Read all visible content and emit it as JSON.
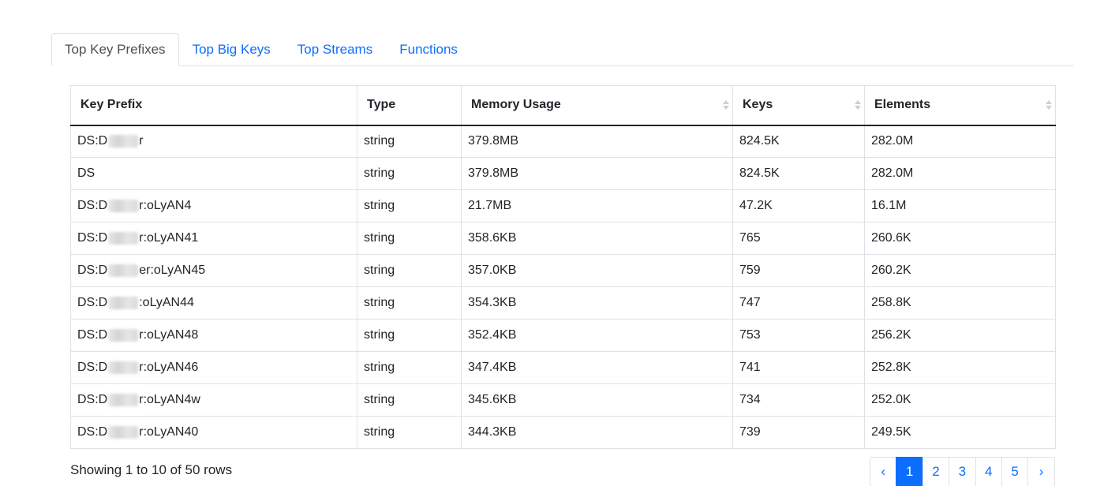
{
  "tabs": [
    {
      "label": "Top Key Prefixes",
      "active": true
    },
    {
      "label": "Top Big Keys",
      "active": false
    },
    {
      "label": "Top Streams",
      "active": false
    },
    {
      "label": "Functions",
      "active": false
    }
  ],
  "table": {
    "columns": [
      {
        "label": "Key Prefix",
        "sortable": false
      },
      {
        "label": "Type",
        "sortable": false
      },
      {
        "label": "Memory Usage",
        "sortable": true
      },
      {
        "label": "Keys",
        "sortable": true
      },
      {
        "label": "Elements",
        "sortable": true
      }
    ],
    "rows": [
      {
        "prefix_start": "DS:D",
        "prefix_end": "r",
        "redacted": true,
        "type": "string",
        "memory": "379.8MB",
        "keys": "824.5K",
        "elements": "282.0M"
      },
      {
        "prefix_start": "DS",
        "prefix_end": "",
        "redacted": false,
        "type": "string",
        "memory": "379.8MB",
        "keys": "824.5K",
        "elements": "282.0M"
      },
      {
        "prefix_start": "DS:D",
        "prefix_end": "r:oLyAN4",
        "redacted": true,
        "type": "string",
        "memory": "21.7MB",
        "keys": "47.2K",
        "elements": "16.1M"
      },
      {
        "prefix_start": "DS:D",
        "prefix_end": "r:oLyAN41",
        "redacted": true,
        "type": "string",
        "memory": "358.6KB",
        "keys": "765",
        "elements": "260.6K"
      },
      {
        "prefix_start": "DS:D",
        "prefix_end": "er:oLyAN45",
        "redacted": true,
        "type": "string",
        "memory": "357.0KB",
        "keys": "759",
        "elements": "260.2K"
      },
      {
        "prefix_start": "DS:D",
        "prefix_end": ":oLyAN44",
        "redacted": true,
        "type": "string",
        "memory": "354.3KB",
        "keys": "747",
        "elements": "258.8K"
      },
      {
        "prefix_start": "DS:D",
        "prefix_end": "r:oLyAN48",
        "redacted": true,
        "type": "string",
        "memory": "352.4KB",
        "keys": "753",
        "elements": "256.2K"
      },
      {
        "prefix_start": "DS:D",
        "prefix_end": "r:oLyAN46",
        "redacted": true,
        "type": "string",
        "memory": "347.4KB",
        "keys": "741",
        "elements": "252.8K"
      },
      {
        "prefix_start": "DS:D",
        "prefix_end": "r:oLyAN4w",
        "redacted": true,
        "type": "string",
        "memory": "345.6KB",
        "keys": "734",
        "elements": "252.0K"
      },
      {
        "prefix_start": "DS:D",
        "prefix_end": "r:oLyAN40",
        "redacted": true,
        "type": "string",
        "memory": "344.3KB",
        "keys": "739",
        "elements": "249.5K"
      }
    ]
  },
  "footer": {
    "showing_text": "Showing 1 to 10 of 50 rows"
  },
  "pagination": {
    "prev_label": "‹",
    "next_label": "›",
    "pages": [
      "1",
      "2",
      "3",
      "4",
      "5"
    ],
    "active_page": "1"
  },
  "colors": {
    "link": "#0d6efd",
    "active_page_bg": "#0d6efd",
    "border": "#dee2e6",
    "text": "#212529"
  }
}
